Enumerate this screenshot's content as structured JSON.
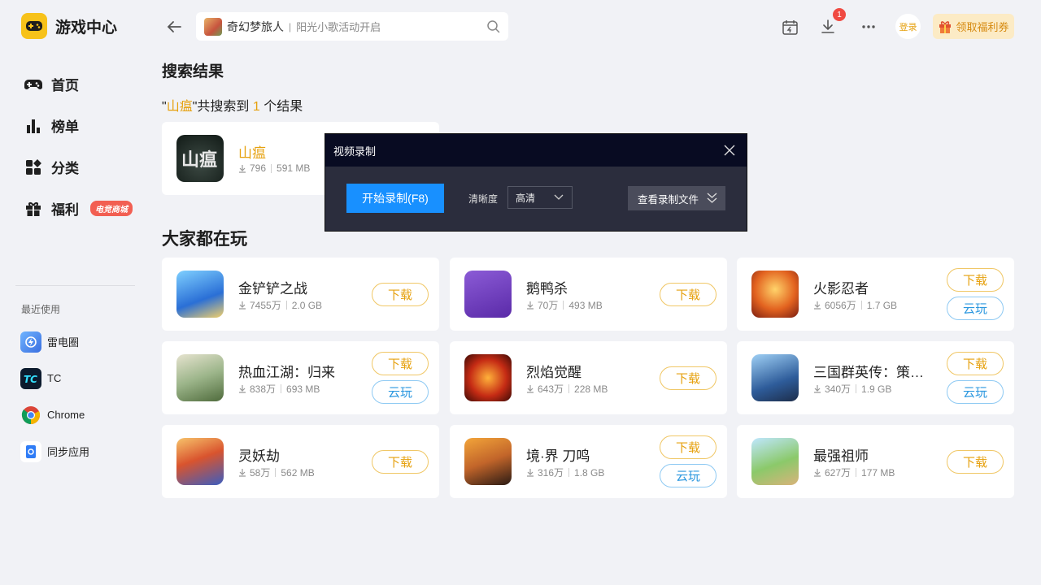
{
  "app": {
    "title": "游戏中心",
    "accent": "#f7c21a"
  },
  "sidebar": {
    "items": [
      {
        "label": "首页",
        "icon": "gamepad-icon"
      },
      {
        "label": "榜单",
        "icon": "ranking-icon"
      },
      {
        "label": "分类",
        "icon": "category-icon"
      },
      {
        "label": "福利",
        "icon": "gift-icon",
        "badge": "电竞商城"
      }
    ],
    "recent_title": "最近使用",
    "recent": [
      {
        "label": "雷电圈",
        "icon": "leidian-circle-icon"
      },
      {
        "label": "TC",
        "icon": "tc-icon"
      },
      {
        "label": "Chrome",
        "icon": "chrome-icon"
      },
      {
        "label": "同步应用",
        "icon": "sync-app-icon"
      }
    ]
  },
  "topbar": {
    "search_game": "奇幻梦旅人",
    "search_sep": "|",
    "search_hint": "阳光小歌活动开启",
    "download_badge": "1",
    "login": "登录",
    "coupon": "领取福利券"
  },
  "search": {
    "heading": "搜索结果",
    "quote_open": "\"",
    "keyword": "山瘟",
    "quote_close": "\"共搜索到 ",
    "count": "1",
    "suffix": " 个结果",
    "result": {
      "name": "山瘟",
      "downloads": "796",
      "size": "591 MB"
    }
  },
  "popular": {
    "heading": "大家都在玩",
    "games": [
      {
        "name": "金铲铲之战",
        "downloads": "7455万",
        "size": "2.0 GB",
        "cloud": false
      },
      {
        "name": "鹅鸭杀",
        "downloads": "70万",
        "size": "493 MB",
        "cloud": false
      },
      {
        "name": "火影忍者",
        "downloads": "6056万",
        "size": "1.7 GB",
        "cloud": true
      },
      {
        "name": "热血江湖：归来",
        "downloads": "838万",
        "size": "693 MB",
        "cloud": true
      },
      {
        "name": "烈焰觉醒",
        "downloads": "643万",
        "size": "228 MB",
        "cloud": false
      },
      {
        "name": "三国群英传：策定九州",
        "downloads": "340万",
        "size": "1.9 GB",
        "cloud": true
      },
      {
        "name": "灵妖劫",
        "downloads": "58万",
        "size": "562 MB",
        "cloud": false
      },
      {
        "name": "境·界 刀鸣",
        "downloads": "316万",
        "size": "1.8 GB",
        "cloud": true
      },
      {
        "name": "最强祖师",
        "downloads": "627万",
        "size": "177 MB",
        "cloud": false
      }
    ],
    "download_label": "下载",
    "cloud_label": "云玩"
  },
  "modal": {
    "title": "视频录制",
    "record_button": "开始录制(F8)",
    "quality_label": "清晰度",
    "quality_value": "高清",
    "view_files": "查看录制文件"
  }
}
